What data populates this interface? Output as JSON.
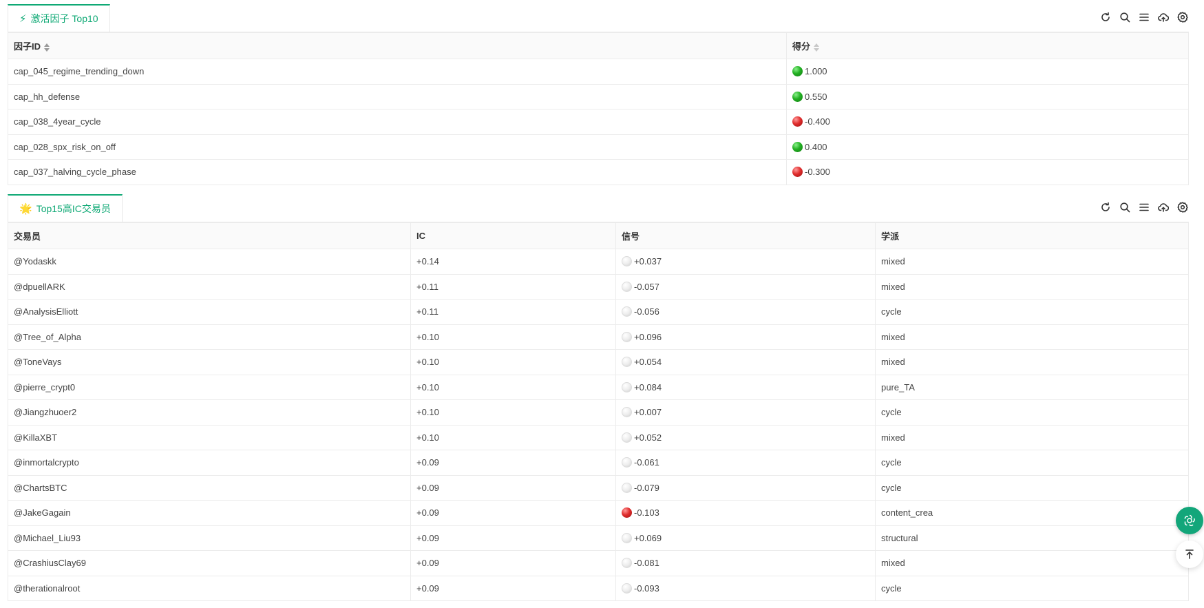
{
  "factors": {
    "tab_icon": "lightning-emoji",
    "tab_icon_char": "⚡",
    "tab_title": "激活因子 Top10",
    "headers": {
      "id": "因子ID",
      "score": "得分"
    },
    "rows": [
      {
        "id": "cap_045_regime_trending_down",
        "status": "green",
        "score": "1.000"
      },
      {
        "id": "cap_hh_defense",
        "status": "green",
        "score": "0.550"
      },
      {
        "id": "cap_038_4year_cycle",
        "status": "red",
        "score": "-0.400"
      },
      {
        "id": "cap_028_spx_risk_on_off",
        "status": "green",
        "score": "0.400"
      },
      {
        "id": "cap_037_halving_cycle_phase",
        "status": "red",
        "score": "-0.300"
      }
    ]
  },
  "traders": {
    "tab_icon": "glowing-star-emoji",
    "tab_icon_char": "🌟",
    "tab_title": "Top15高IC交易员",
    "headers": {
      "trader": "交易员",
      "ic": "IC",
      "signal": "信号",
      "school": "学派"
    },
    "rows": [
      {
        "trader": "@Yodaskk",
        "ic": "+0.14",
        "status": "white",
        "signal": "+0.037",
        "school": "mixed"
      },
      {
        "trader": "@dpuellARK",
        "ic": "+0.11",
        "status": "white",
        "signal": "-0.057",
        "school": "mixed"
      },
      {
        "trader": "@AnalysisElliott",
        "ic": "+0.11",
        "status": "white",
        "signal": "-0.056",
        "school": "cycle"
      },
      {
        "trader": "@Tree_of_Alpha",
        "ic": "+0.10",
        "status": "white",
        "signal": "+0.096",
        "school": "mixed"
      },
      {
        "trader": "@ToneVays",
        "ic": "+0.10",
        "status": "white",
        "signal": "+0.054",
        "school": "mixed"
      },
      {
        "trader": "@pierre_crypt0",
        "ic": "+0.10",
        "status": "white",
        "signal": "+0.084",
        "school": "pure_TA"
      },
      {
        "trader": "@Jiangzhuoer2",
        "ic": "+0.10",
        "status": "white",
        "signal": "+0.007",
        "school": "cycle"
      },
      {
        "trader": "@KillaXBT",
        "ic": "+0.10",
        "status": "white",
        "signal": "+0.052",
        "school": "mixed"
      },
      {
        "trader": "@inmortalcrypto",
        "ic": "+0.09",
        "status": "white",
        "signal": "-0.061",
        "school": "cycle"
      },
      {
        "trader": "@ChartsBTC",
        "ic": "+0.09",
        "status": "white",
        "signal": "-0.079",
        "school": "cycle"
      },
      {
        "trader": "@JakeGagain",
        "ic": "+0.09",
        "status": "red",
        "signal": "-0.103",
        "school": "content_crea"
      },
      {
        "trader": "@Michael_Liu93",
        "ic": "+0.09",
        "status": "white",
        "signal": "+0.069",
        "school": "structural"
      },
      {
        "trader": "@CrashiusClay69",
        "ic": "+0.09",
        "status": "white",
        "signal": "-0.081",
        "school": "mixed"
      },
      {
        "trader": "@therationalroot",
        "ic": "+0.09",
        "status": "white",
        "signal": "-0.093",
        "school": "cycle"
      }
    ]
  },
  "toolbar": [
    "refresh-icon",
    "search-icon",
    "list-icon",
    "cloud-upload-icon",
    "gear-icon"
  ],
  "colors": {
    "accent": "#0fa975",
    "positive": "#22b022",
    "negative": "#e02d2d",
    "neutral": "#eeeeee"
  }
}
